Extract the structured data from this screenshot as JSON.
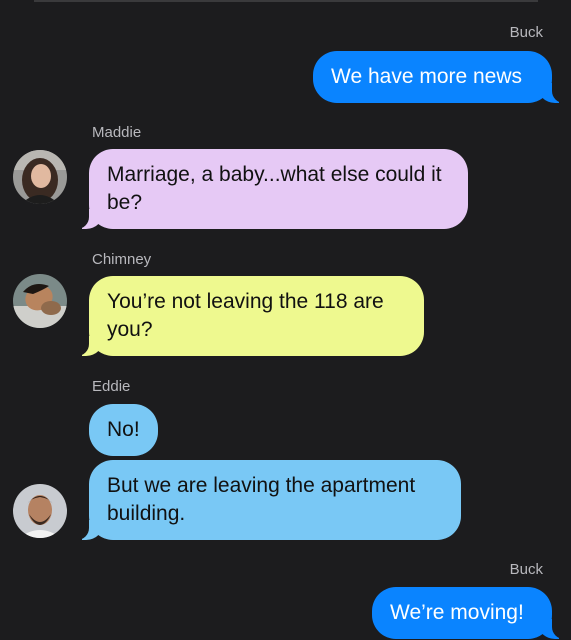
{
  "messages": [
    {
      "sender": "Buck",
      "text": "We have more news"
    },
    {
      "sender": "Maddie",
      "text": "Marriage, a baby...what else could it be?"
    },
    {
      "sender": "Chimney",
      "text": "You’re not leaving the 118 are you?"
    },
    {
      "sender": "Eddie",
      "text": "No!"
    },
    {
      "sender": "Eddie",
      "text": "But we are leaving the apartment building."
    },
    {
      "sender": "Buck",
      "text": "We’re moving!"
    }
  ],
  "senders": {
    "buck_1": "Buck",
    "maddie": "Maddie",
    "chimney": "Chimney",
    "eddie": "Eddie",
    "buck_2": "Buck"
  },
  "colors": {
    "background": "#1c1c1e",
    "outgoing_bubble": "#0a84ff",
    "maddie_bubble": "#e6c9f5",
    "chimney_bubble": "#eef98f",
    "eddie_bubble": "#79c8f5",
    "sender_label": "#b8b8bd"
  }
}
